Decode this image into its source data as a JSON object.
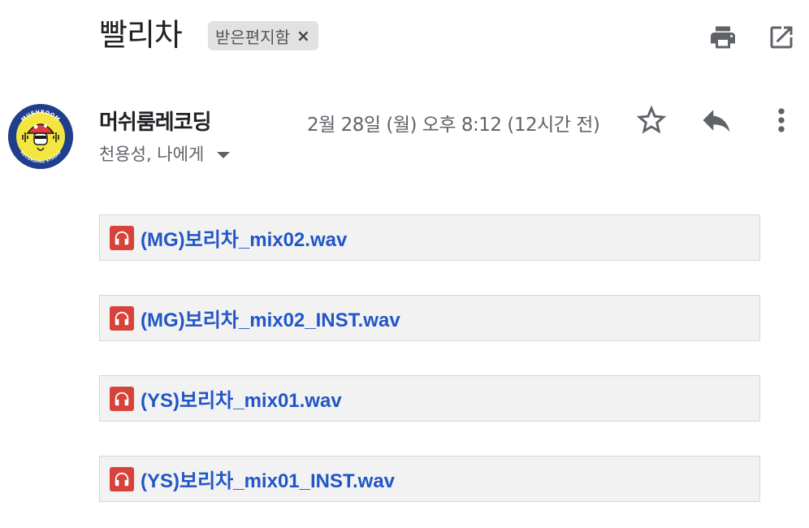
{
  "email": {
    "subject": "빨리차",
    "label": {
      "text": "받은편지함",
      "remove": "×"
    },
    "sender": {
      "name": "머쉬룸레코딩",
      "recipients": "천용성, 나에게"
    },
    "date": "2월 28일 (월) 오후 8:12 (12시간 전)",
    "avatar": {
      "top_text": "MUSHROOM",
      "bottom_text": "RECORDING STUDIO"
    }
  },
  "attachments": [
    {
      "name": "(MG)보리차_mix02.wav"
    },
    {
      "name": "(MG)보리차_mix02_INST.wav"
    },
    {
      "name": "(YS)보리차_mix01.wav"
    },
    {
      "name": "(YS)보리차_mix01_INST.wav"
    }
  ],
  "icons": {
    "print": "print-icon",
    "popout": "open-in-new-window-icon",
    "star": "star-icon",
    "reply": "reply-icon",
    "more": "more-vert-icon",
    "attachment": "audio-file-icon",
    "dropdown": "chevron-down-icon"
  },
  "colors": {
    "link": "#2156c8",
    "attachment_icon": "#d5433b",
    "chip_bg": "#e1e1e1"
  }
}
